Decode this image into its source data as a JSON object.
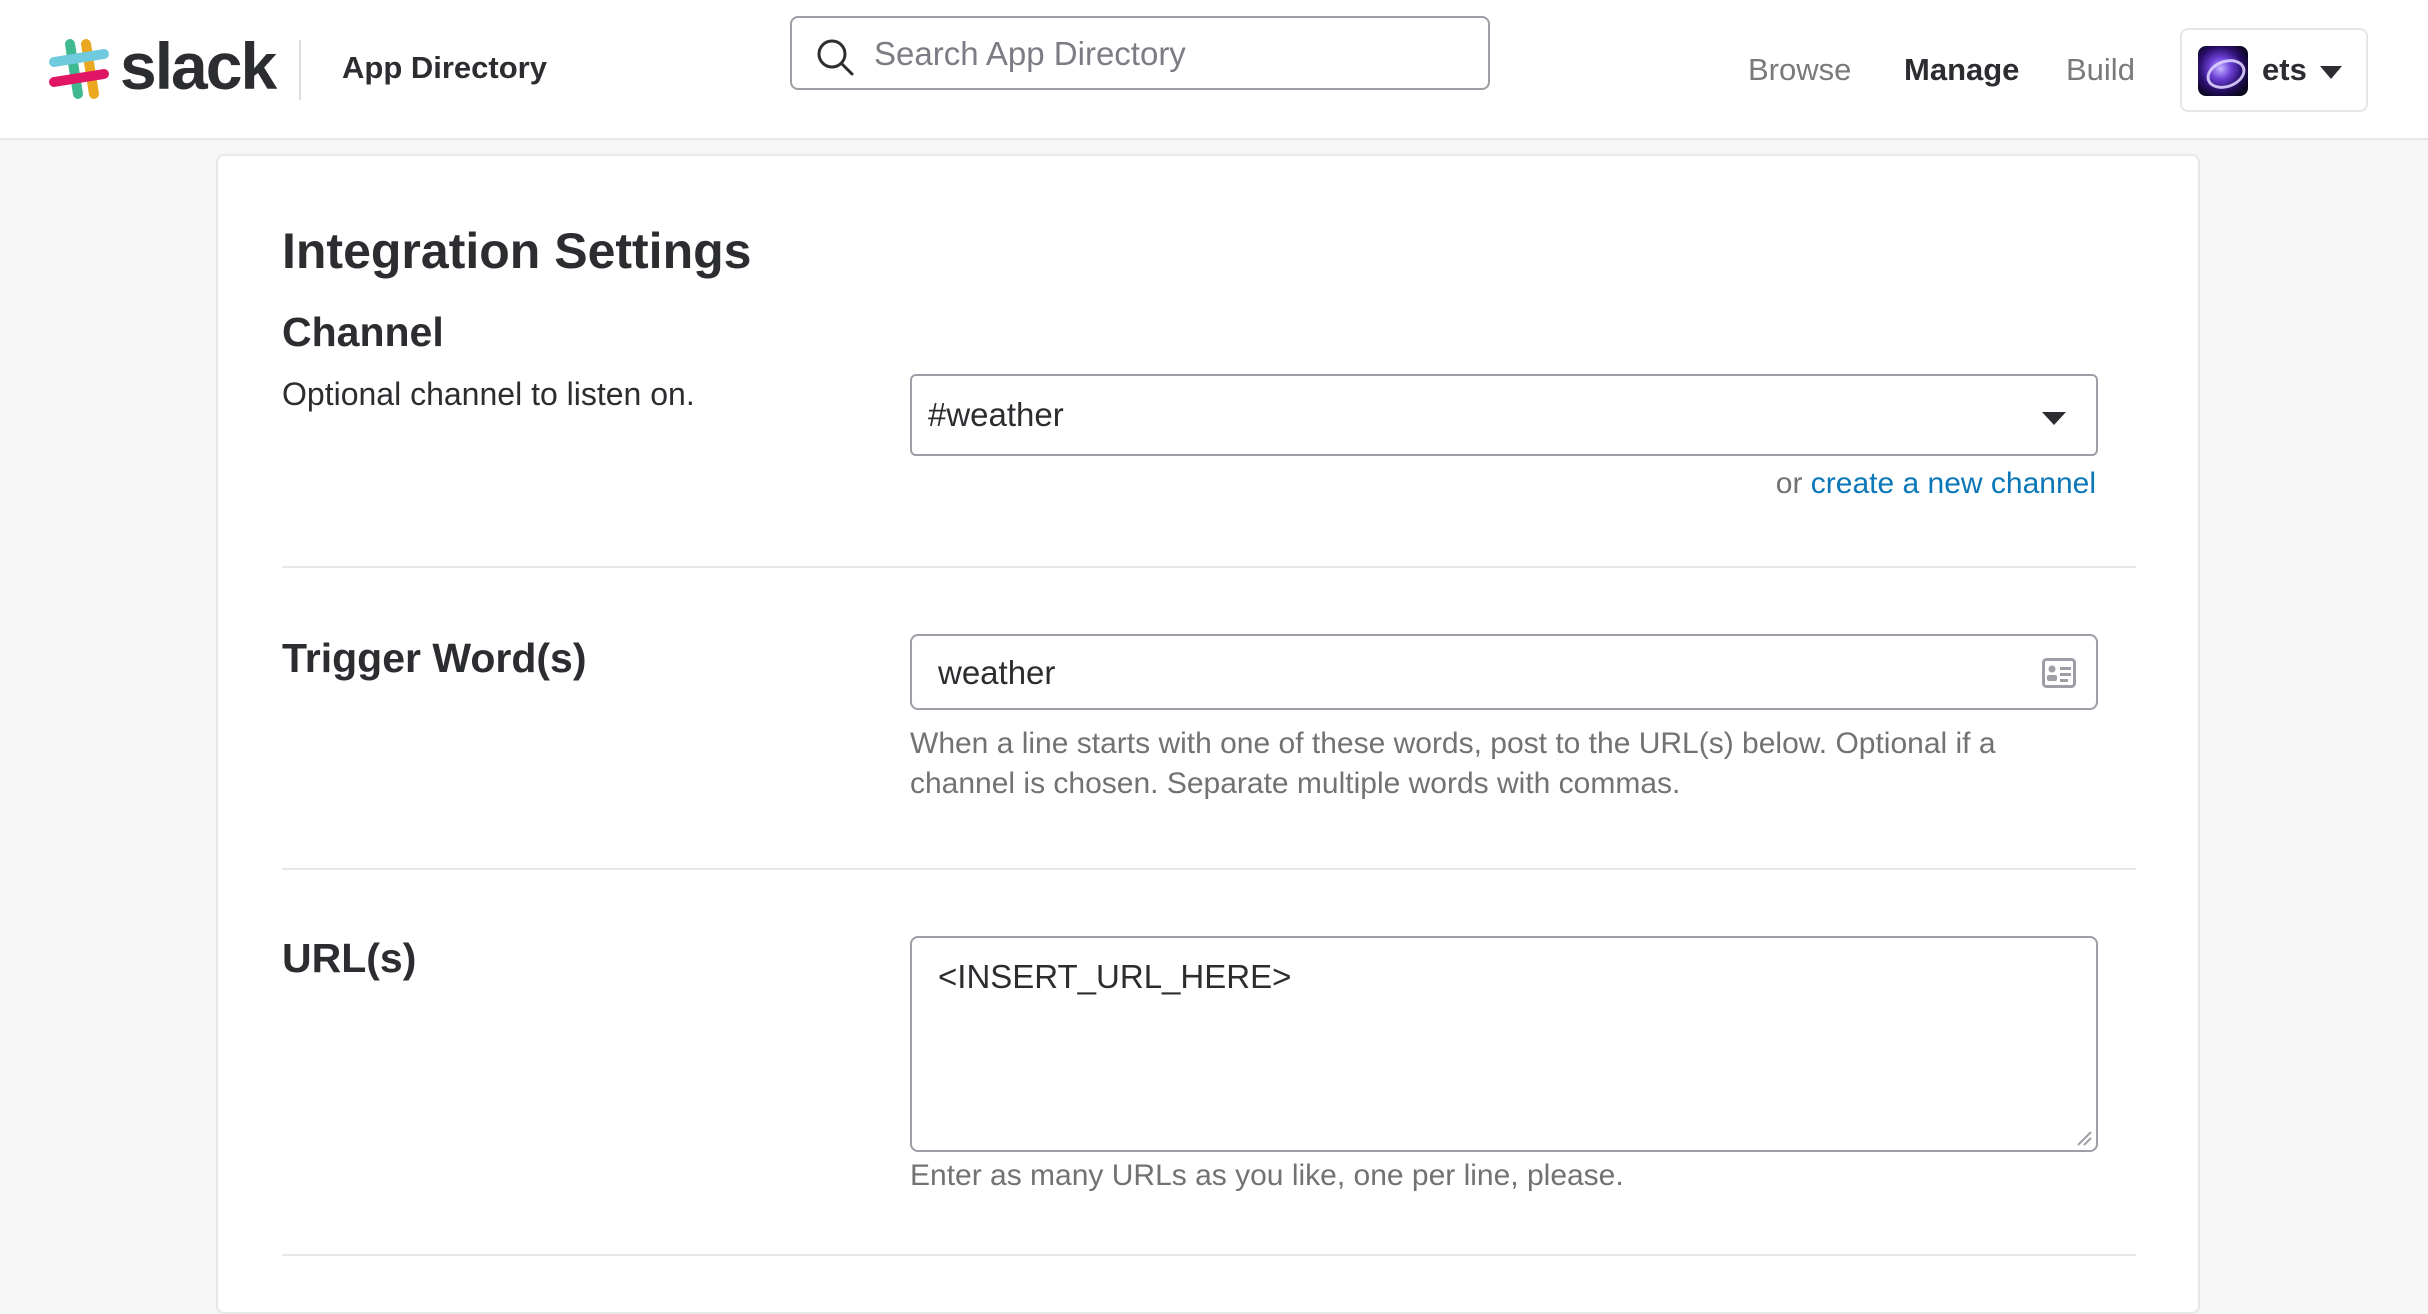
{
  "header": {
    "brand": "slack",
    "app_directory": "App Directory",
    "search": {
      "placeholder": "Search App Directory",
      "value": ""
    },
    "nav": {
      "browse": "Browse",
      "manage": "Manage",
      "build": "Build"
    },
    "team": {
      "name": "ets"
    }
  },
  "page": {
    "title": "Integration Settings",
    "channel": {
      "title": "Channel",
      "description": "Optional channel to listen on.",
      "selected": "#weather",
      "or_text": "or",
      "create_link": "create a new channel"
    },
    "trigger": {
      "title": "Trigger Word(s)",
      "value": "weather",
      "help": "When a line starts with one of these words, post to the URL(s) below. Optional if a channel is chosen. Separate multiple words with commas."
    },
    "urls": {
      "title": "URL(s)",
      "value": "<INSERT_URL_HERE>",
      "help": "Enter as many URLs as you like, one per line, please."
    }
  },
  "colors": {
    "link": "#0b76b8",
    "text": "#2c2d30",
    "muted": "#717274",
    "border": "#9e9ea6",
    "background": "#f6f6f6"
  }
}
